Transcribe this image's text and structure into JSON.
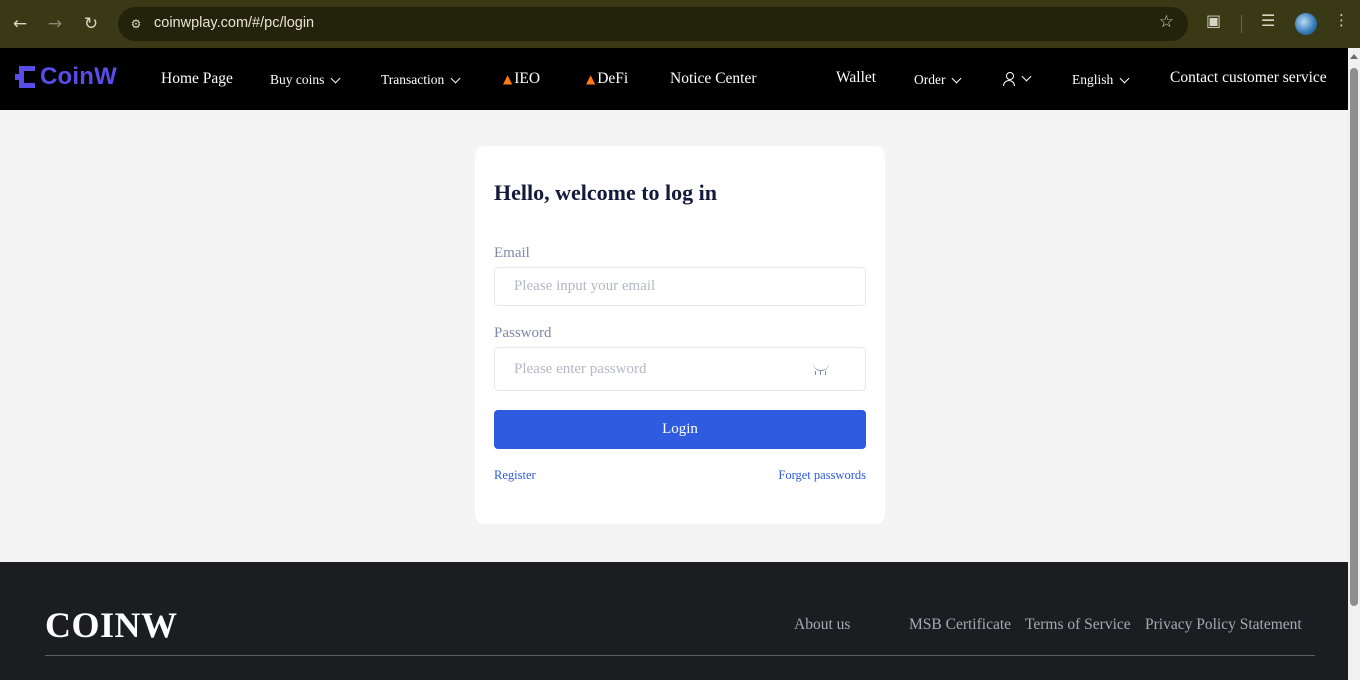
{
  "browser": {
    "url": "coinwplay.com/#/pc/login",
    "icons": [
      "back-icon",
      "forward-icon",
      "reload-icon",
      "site-info-icon",
      "bookmark-star-icon",
      "extensions-icon",
      "media-icon",
      "profile-avatar",
      "menu-icon"
    ]
  },
  "header": {
    "logo_text": "CoinW",
    "nav": {
      "home": "Home Page",
      "buy_coins": "Buy coins",
      "transaction": "Transaction",
      "ieo": "IEO",
      "defi": "DeFi",
      "notice": "Notice Center",
      "wallet": "Wallet",
      "order": "Order",
      "language": "English",
      "contact": "Contact customer service"
    }
  },
  "login": {
    "title": "Hello, welcome to log in",
    "email_label": "Email",
    "email_placeholder": "Please input your email",
    "password_label": "Password",
    "password_placeholder": "Please enter password",
    "login_button": "Login",
    "register_link": "Register",
    "forget_link": "Forget passwords"
  },
  "footer": {
    "logo_text": "COINW",
    "links": {
      "about": "About us",
      "msb": "MSB Certificate",
      "terms": "Terms of Service",
      "privacy": "Privacy Policy Statement"
    }
  },
  "colors": {
    "brand": "#5a4ce8",
    "primary_button": "#2e5be0",
    "header_bg": "#000000",
    "footer_bg": "#1b1d21",
    "page_bg": "#f4f4f5"
  }
}
